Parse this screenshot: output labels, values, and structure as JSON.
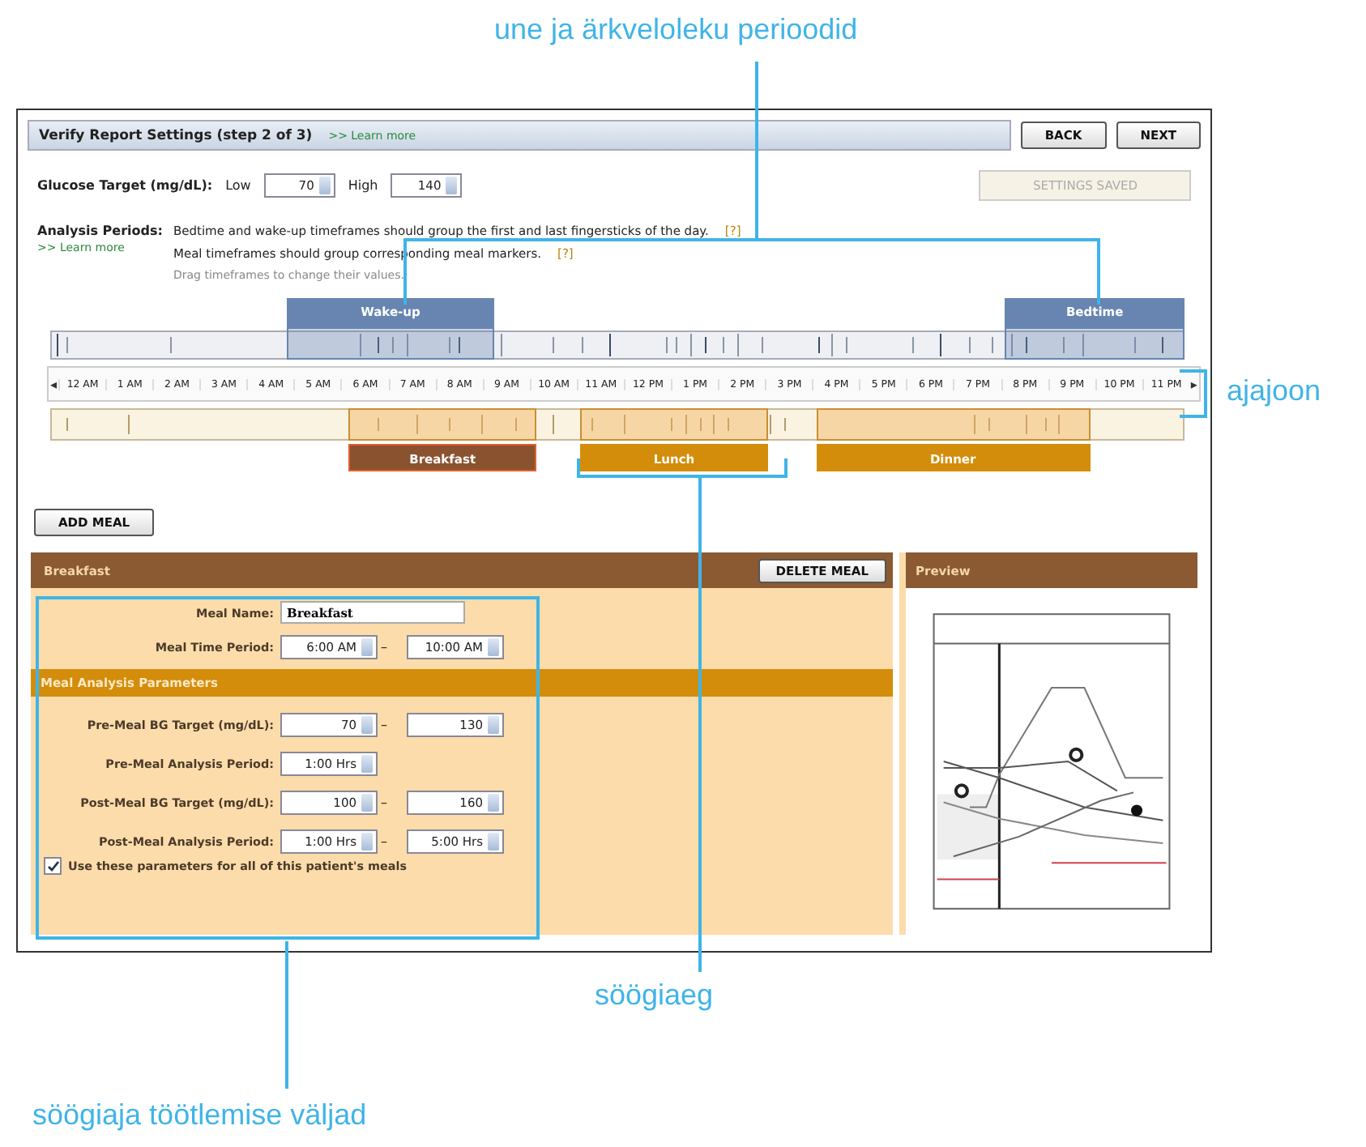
{
  "annotations": [
    {
      "text": "une ja ärkveloleku perioodid"
    },
    {
      "text": "ajajoon"
    },
    {
      "text": "söögiaeg"
    },
    {
      "text": "söögiaja töötlemise väljad"
    }
  ],
  "window": {
    "title": "Verify Report Settings (step 2 of 3)",
    "learn_more": ">> Learn more",
    "buttons": [
      {
        "label": "BACK"
      },
      {
        "label": "NEXT"
      }
    ]
  },
  "glucose_target": {
    "label": "Glucose Target (mg/dL):",
    "low_label": "Low",
    "low": "70",
    "high_label": "High",
    "high": "140",
    "status_button": {
      "label": "SETTINGS SAVED",
      "disabled": true
    }
  },
  "analysis_periods": {
    "label": "Analysis Periods:",
    "learn_more": ">> Learn more",
    "notes": [
      {
        "text": "Bedtime and wake-up timeframes should group the first and last fingersticks of the day.",
        "help": "[?]"
      },
      {
        "text": "Meal timeframes should group corresponding meal markers.",
        "help": "[?]"
      }
    ],
    "hint": "Drag timeframes to change their values."
  },
  "timeline": {
    "prev": "◂",
    "next": "▸",
    "hours": [
      "12 AM",
      "1 AM",
      "2 AM",
      "3 AM",
      "4 AM",
      "5 AM",
      "6 AM",
      "7 AM",
      "8 AM",
      "9 AM",
      "10 AM",
      "11 AM",
      "12 PM",
      "1 PM",
      "2 PM",
      "3 PM",
      "4 PM",
      "5 PM",
      "6 PM",
      "7 PM",
      "8 PM",
      "9 PM",
      "10 PM",
      "11 PM"
    ],
    "periods": [
      {
        "label": "Wake-up"
      },
      {
        "label": "Bedtime"
      }
    ],
    "meals": [
      {
        "label": "Breakfast",
        "selected": true
      },
      {
        "label": "Lunch",
        "selected": false
      },
      {
        "label": "Dinner",
        "selected": false
      }
    ]
  },
  "add_meal": "ADD MEAL",
  "meal_panel": {
    "title": "Breakfast",
    "delete": "DELETE MEAL",
    "rows": [
      {
        "kind": "text",
        "label": "Meal Name:",
        "value": "Breakfast"
      },
      {
        "kind": "range",
        "label": "Meal Time Period:",
        "from": "6:00 AM",
        "separator": "–",
        "to": "10:00 AM"
      }
    ],
    "section": "Meal Analysis Parameters",
    "params": [
      {
        "kind": "range",
        "label": "Pre-Meal BG Target (mg/dL):",
        "from": "70",
        "separator": "–",
        "to": "130"
      },
      {
        "kind": "single",
        "label": "Pre-Meal Analysis Period:",
        "from": "1:00 Hrs"
      },
      {
        "kind": "range",
        "label": "Post-Meal BG Target (mg/dL):",
        "from": "100",
        "separator": "–",
        "to": "160"
      },
      {
        "kind": "range",
        "label": "Post-Meal Analysis Period:",
        "from": "1:00 Hrs",
        "separator": "–",
        "to": "5:00 Hrs"
      }
    ],
    "apply_all": {
      "label": "Use these parameters for all of this patient's meals",
      "checked": true
    }
  },
  "preview": {
    "title": "Preview"
  }
}
